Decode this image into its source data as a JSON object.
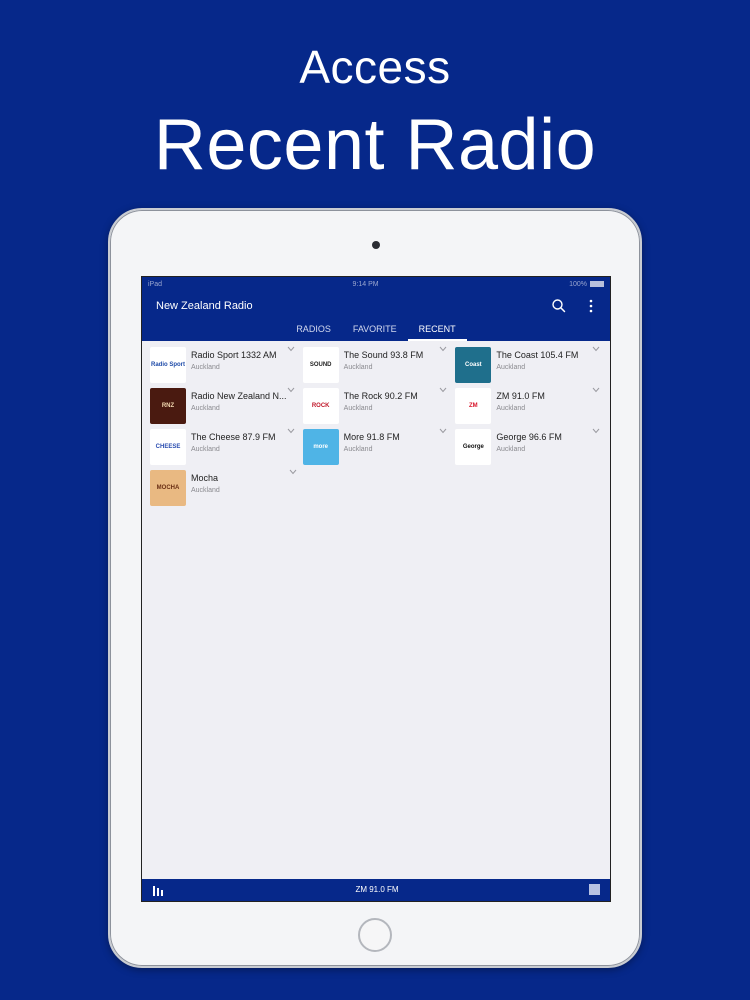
{
  "promo": {
    "line1": "Access",
    "line2": "Recent Radio"
  },
  "status_bar": {
    "left": "iPad",
    "time": "9:14 PM",
    "right": "100%"
  },
  "app": {
    "title": "New Zealand Radio"
  },
  "tabs": [
    {
      "label": "RADIOS"
    },
    {
      "label": "FAVORITE"
    },
    {
      "label": "RECENT"
    }
  ],
  "stations": [
    {
      "name": "Radio Sport 1332 AM",
      "city": "Auckland",
      "logo_bg": "#ffffff",
      "logo_fg": "#1d4aa8",
      "logo_text": "Radio Sport"
    },
    {
      "name": "The Sound 93.8 FM",
      "city": "Auckland",
      "logo_bg": "#ffffff",
      "logo_fg": "#222222",
      "logo_text": "SOUND"
    },
    {
      "name": "The Coast 105.4 FM",
      "city": "Auckland",
      "logo_bg": "#1f6f8c",
      "logo_fg": "#ffffff",
      "logo_text": "Coast"
    },
    {
      "name": "Radio New Zealand N...",
      "city": "Auckland",
      "logo_bg": "#4a1a10",
      "logo_fg": "#f2d8b0",
      "logo_text": "RNZ"
    },
    {
      "name": "The Rock 90.2 FM",
      "city": "Auckland",
      "logo_bg": "#ffffff",
      "logo_fg": "#c0182a",
      "logo_text": "ROCK"
    },
    {
      "name": "ZM 91.0 FM",
      "city": "Auckland",
      "logo_bg": "#ffffff",
      "logo_fg": "#d7142a",
      "logo_text": "ZM"
    },
    {
      "name": "The Cheese 87.9 FM",
      "city": "Auckland",
      "logo_bg": "#ffffff",
      "logo_fg": "#2a4db0",
      "logo_text": "CHEESE"
    },
    {
      "name": "More 91.8 FM",
      "city": "Auckland",
      "logo_bg": "#4fb4e6",
      "logo_fg": "#ffffff",
      "logo_text": "more"
    },
    {
      "name": "George 96.6 FM",
      "city": "Auckland",
      "logo_bg": "#ffffff",
      "logo_fg": "#111111",
      "logo_text": "George"
    },
    {
      "name": "Mocha",
      "city": "Auckland",
      "logo_bg": "#e9b982",
      "logo_fg": "#6b2f14",
      "logo_text": "MOCHA"
    }
  ],
  "player": {
    "now_playing": "ZM 91.0 FM"
  },
  "colors": {
    "brand": "#06288a",
    "background": "#06288a",
    "list_bg": "#efeff4"
  }
}
